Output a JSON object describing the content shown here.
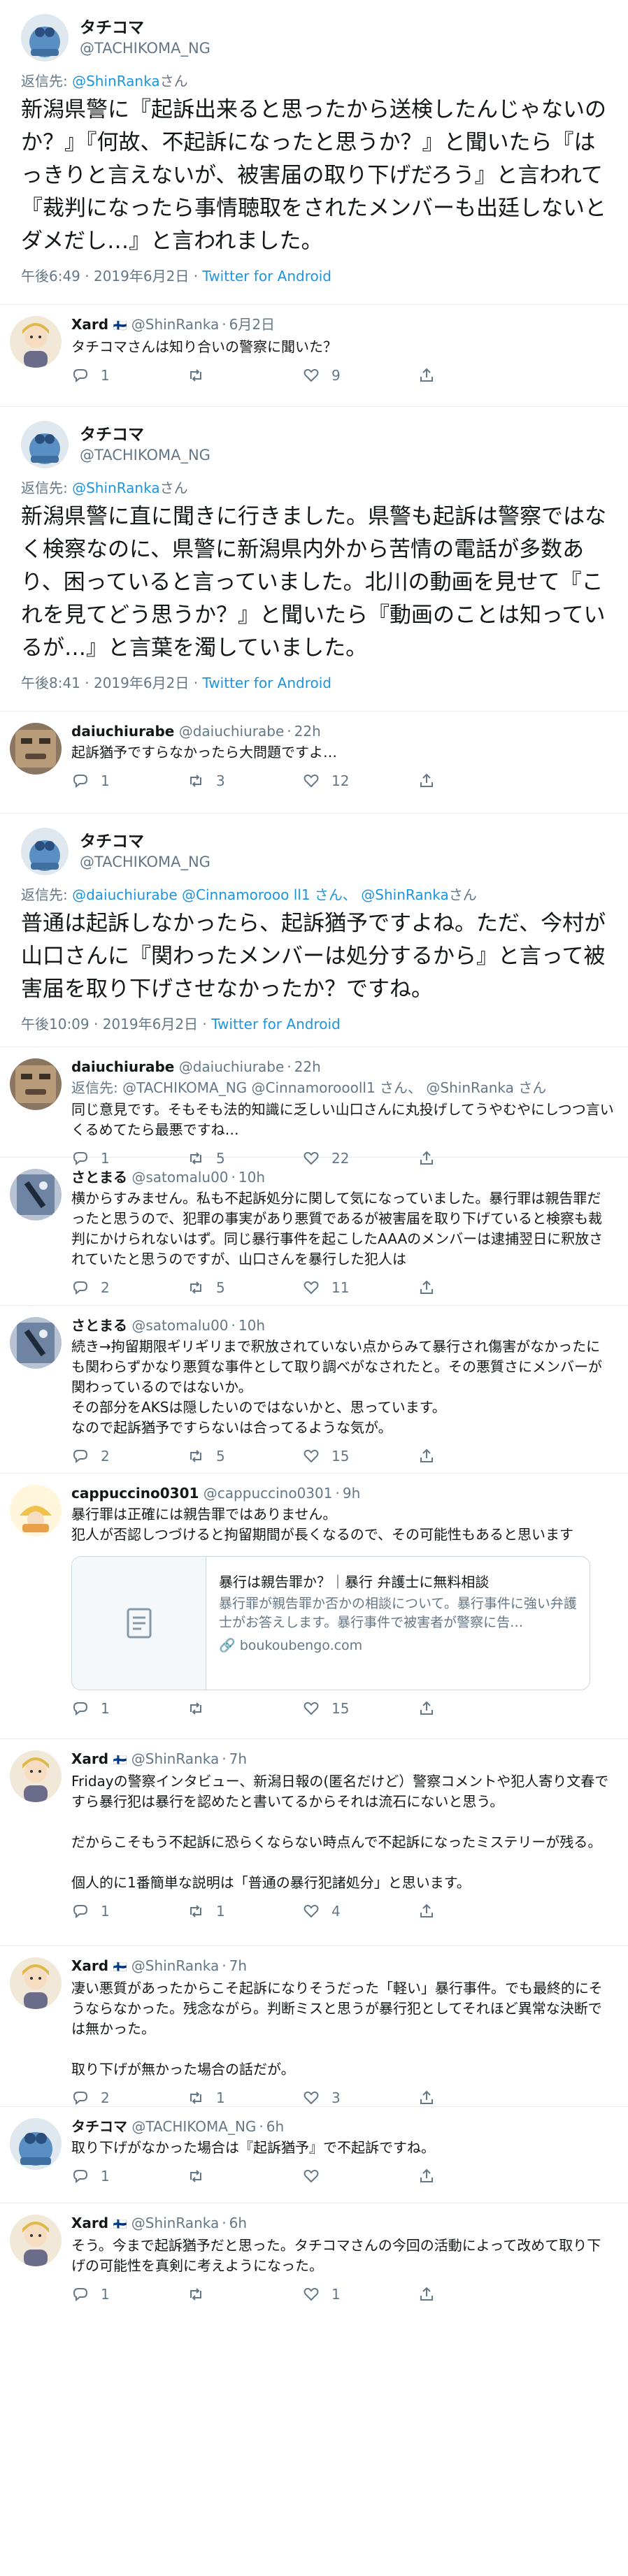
{
  "tweets": [
    {
      "type": "focal",
      "name": "タチコマ",
      "handle": "@TACHIKOMA_NG",
      "reply_prefix": "返信先: ",
      "reply_to": "@ShinRanka",
      "reply_suffix": "さん",
      "text": "新潟県警に『起訴出来ると思ったから送検したんじゃないのか？』『何故、不起訴になったと思うか？』と聞いたら『はっきりと言えないが、被害届の取り下げだろう』と言われて『裁判になったら事情聴取をされたメンバーも出廷しないとダメだし…』と言われました。",
      "time": "午後6:49 · 2019年6月2日 · ",
      "source": "Twitter for Android"
    },
    {
      "type": "reply",
      "name": "Xard",
      "flag": "🇫🇮",
      "handle": "@ShinRanka",
      "date": "6月2日",
      "text": "タチコマさんは知り合いの警察に聞いた？",
      "replies": "1",
      "retweets": "",
      "likes": "9"
    },
    {
      "type": "focal",
      "name": "タチコマ",
      "handle": "@TACHIKOMA_NG",
      "reply_prefix": "返信先: ",
      "reply_to": "@ShinRanka",
      "reply_suffix": "さん",
      "text": "新潟県警に直に聞きに行きました。県警も起訴は警察ではなく検察なのに、県警に新潟県内外から苦情の電話が多数あり、困っていると言っていました。北川の動画を見せて『これを見てどう思うか？』と聞いたら『動画のことは知っているが…』と言葉を濁していました。",
      "time": "午後8:41 · 2019年6月2日 · ",
      "source": "Twitter for Android"
    },
    {
      "type": "reply",
      "name": "daiuchiurabe",
      "flag": "",
      "handle": "@daiuchiurabe",
      "date": "22h",
      "text": "起訴猶予ですらなかったら大問題ですよ…",
      "replies": "1",
      "retweets": "3",
      "likes": "12"
    },
    {
      "type": "focal",
      "name": "タチコマ",
      "handle": "@TACHIKOMA_NG",
      "reply_prefix": "返信先: ",
      "reply_to": "@daiuchiurabe @Cinnamorooo ll1 さん、 @ShinRanka",
      "reply_suffix": "さん",
      "text": "普通は起訴しなかったら、起訴猶予ですよね。ただ、今村が山口さんに『関わったメンバーは処分するから』と言って被害届を取り下げさせなかったか？ですね。",
      "time": "午後10:09 · 2019年6月2日 · ",
      "source": "Twitter for Android"
    }
  ],
  "replies": [
    {
      "name": "daiuchiurabe",
      "flag": "",
      "handle": "@daiuchiurabe",
      "date": "22h",
      "reply_line": "返信先: @TACHIKOMA_NG @Cinnamoroooll1 さん、 @ShinRanka さん",
      "text": "同じ意見です。そもそも法的知識に乏しい山口さんに丸投げしてうやむやにしつつ言いくるめてたら最悪ですね…",
      "replies": "1",
      "retweets": "5",
      "likes": "22"
    },
    {
      "name": "さとまる",
      "flag": "",
      "handle": "@satomalu00",
      "date": "10h",
      "text": "横からすみません。私も不起訴処分に関して気になっていました。暴行罪は親告罪だったと思うので、犯罪の事実があり悪質であるが被害届を取り下げていると検察も裁判にかけられないはず。同じ暴行事件を起こしたAAAのメンバーは逮捕翌日に釈放されていたと思うのですが、山口さんを暴行した犯人は",
      "replies": "2",
      "retweets": "5",
      "likes": "11"
    },
    {
      "name": "さとまる",
      "flag": "",
      "handle": "@satomalu00",
      "date": "10h",
      "text": "続き→拘留期限ギリギリまで釈放されていない点からみて暴行され傷害がなかったにも関わらずかなり悪質な事件として取り調べがなされたと。その悪質さにメンバーが関わっているのではないか。\nその部分をAKSは隠したいのではないかと、思っています。\nなので起訴猶予ですらないは合ってるような気が。",
      "replies": "2",
      "retweets": "5",
      "likes": "15"
    },
    {
      "name": "cappuccino0301",
      "flag": "",
      "handle": "@cappuccino0301",
      "date": "9h",
      "text": "暴行罪は正確には親告罪ではありません。\n犯人が否認しつづけると拘留期間が長くなるので、その可能性もあると思います",
      "card": {
        "title": "暴行は親告罪か？｜暴行 弁護士に無料相談",
        "desc": "暴行罪が親告罪か否かの相談について。暴行事件に強い弁護士がお答えします。暴行事件で被害者が警察に告…",
        "url": "boukoubengo.com"
      },
      "replies": "1",
      "retweets": "",
      "likes": "15"
    },
    {
      "name": "Xard",
      "flag": "🇫🇮",
      "handle": "@ShinRanka",
      "date": "7h",
      "text": "Fridayの警察インタビュー、新潟日報の(匿名だけど）警察コメントや犯人寄り文春ですら暴行犯は暴行を認めたと書いてるからそれは流石にないと思う。\n\nだからこそもう不起訴に恐らくならない時点んで不起訴になったミステリーが残る。\n\n個人的に1番簡単な説明は「普通の暴行犯諸処分」と思います。",
      "replies": "1",
      "retweets": "1",
      "likes": "4"
    },
    {
      "name": "Xard",
      "flag": "🇫🇮",
      "handle": "@ShinRanka",
      "date": "7h",
      "text": "凄い悪質があったからこそ起訴になりそうだった「軽い」暴行事件。でも最終的にそうならなかった。残念ながら。判断ミスと思うが暴行犯としてそれほど異常な決断では無かった。\n\n取り下げが無かった場合の話だが。",
      "replies": "2",
      "retweets": "1",
      "likes": "3"
    },
    {
      "name": "タチコマ",
      "flag": "",
      "handle": "@TACHIKOMA_NG",
      "date": "6h",
      "text": "取り下げがなかった場合は『起訴猶予』で不起訴ですね。",
      "replies": "1",
      "retweets": "",
      "likes": ""
    },
    {
      "name": "Xard",
      "flag": "🇫🇮",
      "handle": "@ShinRanka",
      "date": "6h",
      "text": "そう。今まで起訴猶予だと思った。タチコマさんの今回の活動によって改めて取り下げの可能性を真剣に考えようになった。",
      "replies": "1",
      "retweets": "",
      "likes": "1"
    }
  ],
  "colors": {
    "accent": "#1b95e0",
    "muted": "#657786",
    "text": "#14171a",
    "border": "#e6ecf0"
  }
}
